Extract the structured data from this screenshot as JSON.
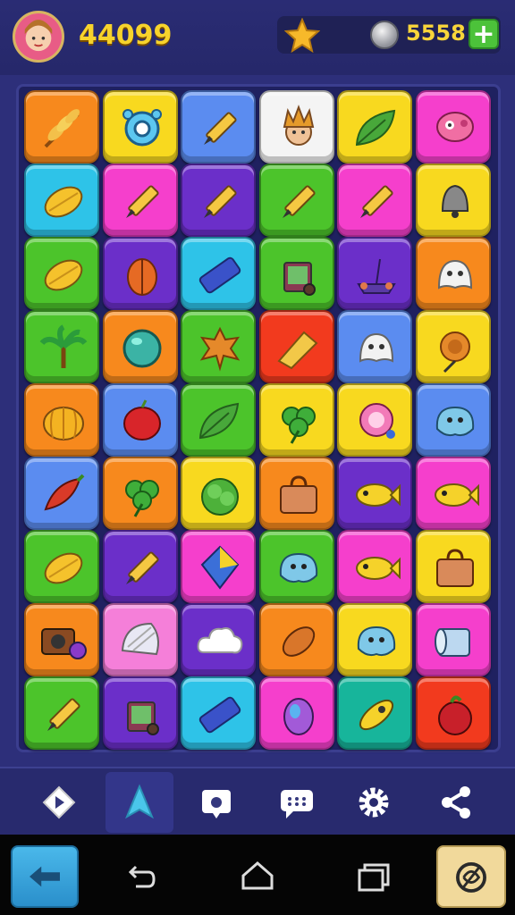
{
  "header": {
    "score": "44099",
    "coins": "5558",
    "add_label": "+"
  },
  "board": {
    "rows": 9,
    "cols": 6,
    "tiles": [
      [
        "orange",
        "wheat-icon"
      ],
      [
        "yellow",
        "robot-icon"
      ],
      [
        "blue",
        "pencil-icon"
      ],
      [
        "white",
        "face-icon"
      ],
      [
        "yellow",
        "leaf-icon"
      ],
      [
        "magenta",
        "octopus-icon"
      ],
      [
        "cyan",
        "lemon-icon"
      ],
      [
        "magenta",
        "pencil-icon"
      ],
      [
        "purple",
        "pencil-icon"
      ],
      [
        "green",
        "pencil-icon"
      ],
      [
        "magenta",
        "pencil-icon"
      ],
      [
        "yellow",
        "bell-icon"
      ],
      [
        "green",
        "lemon-icon"
      ],
      [
        "purple",
        "lantern-icon"
      ],
      [
        "cyan",
        "eraser-icon"
      ],
      [
        "green",
        "trash-icon"
      ],
      [
        "purple",
        "cart-icon"
      ],
      [
        "orange",
        "ghost-icon"
      ],
      [
        "green",
        "palm-icon"
      ],
      [
        "orange",
        "ball-icon"
      ],
      [
        "green",
        "maple-leaf-icon"
      ],
      [
        "red",
        "gem-icon"
      ],
      [
        "blue",
        "ghost-icon"
      ],
      [
        "yellow",
        "flower-icon"
      ],
      [
        "orange",
        "pumpkin-icon"
      ],
      [
        "blue",
        "apple-icon"
      ],
      [
        "green",
        "leaf-icon"
      ],
      [
        "yellow",
        "clover-icon"
      ],
      [
        "yellow",
        "candy-icon"
      ],
      [
        "blue",
        "monster-icon"
      ],
      [
        "blue",
        "pepper-icon"
      ],
      [
        "orange",
        "clover-icon"
      ],
      [
        "yellow",
        "cabbage-icon"
      ],
      [
        "orange",
        "bag-icon"
      ],
      [
        "purple",
        "fish-icon"
      ],
      [
        "magenta",
        "fish-icon"
      ],
      [
        "green",
        "lemon-icon"
      ],
      [
        "purple",
        "pencil-icon"
      ],
      [
        "magenta",
        "kite-icon"
      ],
      [
        "green",
        "monster-icon"
      ],
      [
        "magenta",
        "fish-icon"
      ],
      [
        "yellow",
        "bag-icon"
      ],
      [
        "orange",
        "camera-icon"
      ],
      [
        "pink",
        "shell-icon"
      ],
      [
        "purple",
        "cloud-icon"
      ],
      [
        "orange",
        "seed-icon"
      ],
      [
        "yellow",
        "monster-icon"
      ],
      [
        "magenta",
        "towel-icon"
      ],
      [
        "green",
        "pencil-icon"
      ],
      [
        "purple",
        "trash-icon"
      ],
      [
        "cyan",
        "eraser-icon"
      ],
      [
        "magenta",
        "egg-icon"
      ],
      [
        "teal",
        "rocket-icon"
      ],
      [
        "red",
        "berry-icon"
      ]
    ]
  },
  "colors": {
    "orange": "#f7891d",
    "yellow": "#f8d91f",
    "blue": "#5b8cf0",
    "white": "#f4f4f4",
    "magenta": "#f53fcc",
    "cyan": "#2ec3e8",
    "purple": "#6b2fc9",
    "green": "#4cc42b",
    "red": "#f23a1e",
    "pink": "#f57fd9",
    "teal": "#17b59b"
  },
  "toolbar": [
    {
      "name": "diamond-icon",
      "active": false
    },
    {
      "name": "star-icon",
      "active": true
    },
    {
      "name": "photo-icon",
      "active": false
    },
    {
      "name": "chat-icon",
      "active": false
    },
    {
      "name": "gear-icon",
      "active": false
    },
    {
      "name": "share-icon",
      "active": false
    }
  ],
  "navbar": {
    "left_app": "back-arrow-icon",
    "back": "back-icon",
    "home": "home-icon",
    "recents": "recents-icon",
    "right_app": "swirl-icon"
  }
}
